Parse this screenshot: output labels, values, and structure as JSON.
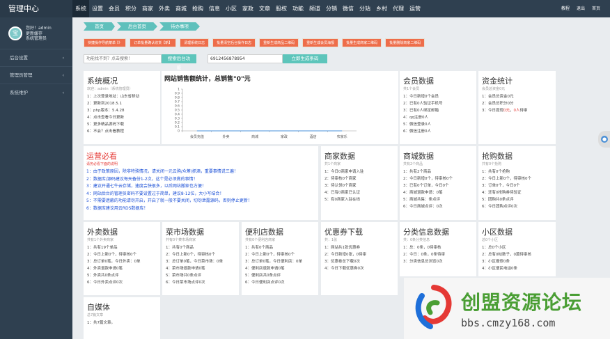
{
  "brand": "管理中心",
  "nav": [
    "系统",
    "设置",
    "会员",
    "积分",
    "商家",
    "外卖",
    "商城",
    "抢购",
    "信息",
    "小区",
    "家政",
    "文章",
    "股权",
    "功能",
    "频道",
    "分销",
    "微信",
    "分站",
    "乡村",
    "代理",
    "运营"
  ],
  "topright": [
    "教程",
    "退出",
    "首页"
  ],
  "profile": {
    "avatar_text": "宝",
    "line1": "您好！admin",
    "line2": "更新缓存",
    "line3": "系统管理员"
  },
  "sidebar": [
    "后台设置",
    "管理员管理",
    "系统维护"
  ],
  "breadcrumbs": [
    "首页",
    "后台首页",
    "待办事项"
  ],
  "quick_buttons": [
    "快捷操作导航菜单 》》",
    "订单批量确认收货【新】",
    "清理系统日志",
    "批量清空后台操作日志",
    "重新生成商品二维码",
    "重新生成会员海报",
    "批量生成商家二维码",
    "批量删除商家二维码"
  ],
  "search": {
    "placeholder": "功能找不到？点击搜索！",
    "button": "搜索后台功能",
    "code_value": "6912456878954",
    "code_button": "立即生成条码"
  },
  "overview": {
    "title": "系统概况",
    "sub": "欢迎：admin（系统管理员）",
    "lines": [
      "1：上次登录地址：山东省移动",
      "2：更新到2018.5.1",
      "3：php版本：5.4.28",
      "4：点击查看今日更新",
      "5：更多精品源码下载",
      "6：不会？点击看教程"
    ]
  },
  "chart_data": {
    "type": "line",
    "title": "网站销售额统计，总销售\"0\"元",
    "categories": [
      "会员充值",
      "外卖",
      "商城",
      "家政",
      "酒店",
      "农家乐"
    ],
    "values": [
      0,
      0,
      0,
      0,
      0,
      0
    ],
    "ylim": [
      0,
      1
    ],
    "yticks": [
      "0",
      "0.1",
      "0.2",
      "0.3",
      "0.4",
      "0.5",
      "0.6",
      "0.7",
      "0.8",
      "0.9",
      "1"
    ],
    "xlabel": "",
    "ylabel": "",
    "legend": "none",
    "grid": false,
    "line_color": "#4a90d9"
  },
  "member": {
    "title": "会员数据",
    "sub": "共1个会员",
    "lines": [
      "1：今日新增0个会员",
      "2：已有0人验证手机号",
      "3：已有0人绑定邮箱",
      "4：qq注册0人",
      "5：微信登录0人",
      "6：微信注册0人"
    ]
  },
  "funds": {
    "title": "资金统计",
    "sub": "会员总资金0元",
    "lines": [
      "1：会员总资金0元",
      "2：会员总积分0分"
    ],
    "line3_prefix": "3：今日提现",
    "line3_red": "0元",
    "line3_suffix": "，",
    "line3_red2": "0人",
    "line3_end": "待审"
  },
  "ops": {
    "title": "运营必看",
    "sub": "请务必看下面的说明",
    "lines": [
      "1：由于政策原因，除非特殊情况，请关闭一元云购/众筹/抓酒，重要事情说三遍！",
      "2：数据库/源码建议每天备份1-2次，这个是必须做的事情！",
      "3：建议开通七牛云存储，速度会快很多，以后网站搬家也方便！",
      "4：网站后台的管理员密码不要设置过于简单，建议8-12位，大小写结合！",
      "5：不需要遮蔽的功能请勿开启，开启了就一般不要关闭，切勿泄露源码，否则停止更新！",
      "6：数据库建议用云RDS数据库！"
    ]
  },
  "merchant": {
    "title": "商家数据",
    "sub": "共1个商家",
    "lines": [
      "1：今日0商家申请入驻",
      "2：待审核0个商家",
      "3：待认领0个商家",
      "4：已有0商家已认证",
      "5：有0商家入驻在线"
    ]
  },
  "mall": {
    "title": "商城数据",
    "sub": "共有2个商品",
    "lines": [
      "1：共有2个商品",
      "2：今日新增0个，待审核0个",
      "3：已有0个订单，今日0个",
      "4：商城退款申请：0笔",
      "5：商城共售：条点评",
      "6：今日商城点评：0次"
    ]
  },
  "flash": {
    "title": "抢购数据",
    "sub": "共有0个抢购",
    "lines": [
      "1：共有0个抢购",
      "2：今日上新0个，待审核0个",
      "3：订单0个，今日0个",
      "4：还有0抢购券待验证",
      "5：团购共0条点评",
      "6：今日团购点评0次"
    ]
  },
  "takeout": {
    "title": "外卖数据",
    "sub": "共有1个外卖商家",
    "lines": [
      "1：共有19个单品",
      "2：今日上新0个，待审核0个",
      "3：总订单0笔，今日外卖：0单",
      "4：外卖退款申请0笔",
      "5：外卖共0条点评",
      "6：今日外卖点评0次"
    ]
  },
  "market": {
    "title": "菜市场数据",
    "sub": "共有0个菜市场商家",
    "lines": [
      "1：共有0个商品",
      "2：今日上新0个，待审核0个",
      "3：总订单0笔，今日菜市场：0单",
      "4：菜市场退款申请0笔",
      "5：菜市场共0条点评",
      "6：今日菜市场点评0次"
    ]
  },
  "store": {
    "title": "便利店数据",
    "sub": "共有0个便利店商家",
    "lines": [
      "1：共有0个商品",
      "2：今日上新0个，待审核0个",
      "3：总订单0笔，今日便利店：0单",
      "4：便利店退款申请0笔",
      "5：便利店共0条点评",
      "6：今日便利店点评0次"
    ]
  },
  "coupon": {
    "title": "优惠券下载",
    "sub": "共：1张",
    "lines": [
      "1：网站共1张优惠券",
      "2：今日新增0张，0待审",
      "3：优惠卷总下载0次",
      "4：今日下载优惠券0次"
    ]
  },
  "classified": {
    "title": "分类信息数据",
    "sub": "共：0条分类信息",
    "lines": [
      "1：总：0条，0待审核",
      "2：今日：0条，0条待审",
      "3：分类信息总浏览0次"
    ]
  },
  "community": {
    "title": "小区数据",
    "sub": "总0个小区",
    "lines": [
      "1：总0个小区",
      "2：总有0帖数子，0篇待审核",
      "3：小区报修0条",
      "4：小区便民电话0条"
    ]
  },
  "media": {
    "title": "自媒体",
    "sub": "总7篇文章",
    "lines": [
      "1：共7篇文章。"
    ]
  },
  "watermark": {
    "text": "创盟资源论坛",
    "url": "bbs.cmzy168.com"
  },
  "colors": {
    "topbar": "#2f4050",
    "accent": "#5fc0bc",
    "orange": "#ee6d4a",
    "red": "#e53935",
    "link": "#1a4fd6"
  }
}
